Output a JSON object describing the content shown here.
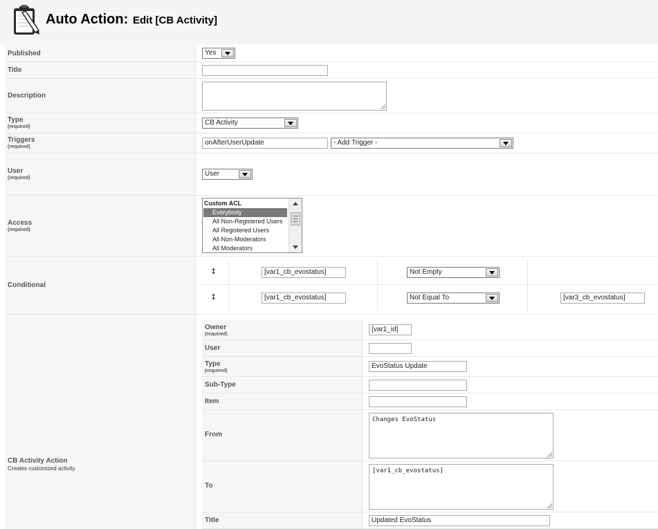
{
  "header": {
    "title_main": "Auto Action:",
    "title_sub": "Edit [CB Activity]"
  },
  "required_text": "(required)",
  "fields": {
    "published": {
      "label": "Published",
      "value": "Yes"
    },
    "title": {
      "label": "Title",
      "value": ""
    },
    "description": {
      "label": "Description",
      "value": ""
    },
    "type": {
      "label": "Type",
      "value": "CB Activity"
    },
    "triggers": {
      "label": "Triggers",
      "value": "onAfterUserUpdate",
      "add_trigger": "- Add Trigger -"
    },
    "user": {
      "label": "User",
      "value": "User"
    },
    "access": {
      "label": "Access",
      "options": [
        "Custom ACL",
        "Everybody",
        "All Non-Registered Users",
        "All Registered Users",
        "All Non-Moderators",
        "All Moderators"
      ],
      "selected": "Everybody"
    },
    "conditional": {
      "label": "Conditional",
      "rows": [
        {
          "field": "[var1_cb_evostatus]",
          "operator": "Not Empty",
          "value": ""
        },
        {
          "field": "[var1_cb_evostatus]",
          "operator": "Not Equal To",
          "value": "[var3_cb_evostatus]"
        }
      ]
    }
  },
  "cb_activity_action": {
    "label": "CB Activity Action",
    "description": "Creates customized activity.",
    "owner": {
      "label": "Owner",
      "value": "[var1_id]"
    },
    "user": {
      "label": "User",
      "value": ""
    },
    "type": {
      "label": "Type",
      "value": "EvoStatus Update"
    },
    "subtype": {
      "label": "Sub-Type",
      "value": ""
    },
    "item": {
      "label": "Item",
      "value": ""
    },
    "from": {
      "label": "From",
      "value": "Changes EvoStatus"
    },
    "to": {
      "label": "To",
      "value": "[var1_cb_evostatus]"
    },
    "title": {
      "label": "Title",
      "value": "Updated EvoStatus"
    }
  }
}
